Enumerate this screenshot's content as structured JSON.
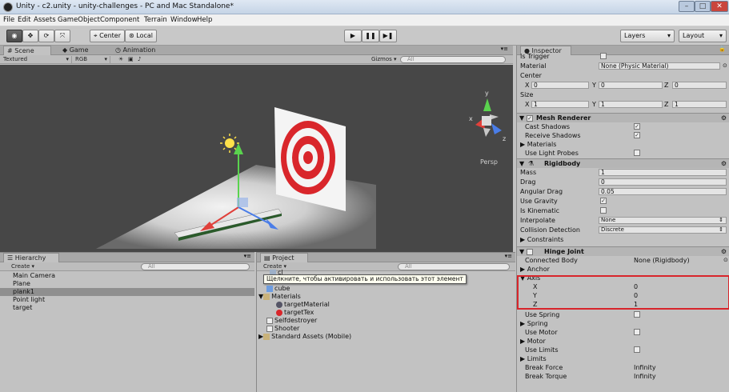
{
  "window": {
    "title": "Unity - c2.unity - unity-challenges - PC and Mac Standalone*"
  },
  "menu": [
    "File",
    "Edit",
    "Assets",
    "GameObject",
    "Component",
    "Terrain",
    "Window",
    "Help"
  ],
  "toolbar": {
    "center": "Center",
    "local": "Local",
    "layers": "Layers",
    "layout": "Layout"
  },
  "scene": {
    "tabs": [
      "Scene",
      "Game",
      "Animation"
    ],
    "shading": "Textured",
    "render": "RGB",
    "gizmos": "Gizmos",
    "search": "All",
    "persp": "Persp",
    "gizmo_axes": {
      "x": "x",
      "y": "y",
      "z": "z"
    }
  },
  "hierarchy": {
    "title": "Hierarchy",
    "create": "Create",
    "search": "All",
    "items": [
      "Main Camera",
      "Plane",
      "plank1",
      "Point light",
      "target"
    ]
  },
  "project": {
    "title": "Project",
    "create": "Create",
    "search": "All",
    "tooltip": "Щелкните, чтобы активировать и использовать этот элемент",
    "partial_item": "cl",
    "items": [
      "cube",
      "Materials",
      "targetMaterial",
      "targetTex",
      "Selfdestroyer",
      "Shooter",
      "Standard Assets (Mobile)"
    ]
  },
  "inspector": {
    "title": "Inspector",
    "collider": {
      "is_trigger": "Is Trigger",
      "material_label": "Material",
      "material_value": "None (Physic Material)",
      "center_label": "Center",
      "center": {
        "x": "0",
        "y": "0",
        "z": "0"
      },
      "size_label": "Size",
      "size": {
        "x": "1",
        "y": "1",
        "z": "1"
      }
    },
    "mesh_renderer": {
      "title": "Mesh Renderer",
      "cast_shadows": "Cast Shadows",
      "receive_shadows": "Receive Shadows",
      "materials": "Materials",
      "use_light_probes": "Use Light Probes"
    },
    "rigidbody": {
      "title": "Rigidbody",
      "mass_label": "Mass",
      "mass": "1",
      "drag_label": "Drag",
      "drag": "0",
      "angular_drag_label": "Angular Drag",
      "angular_drag": "0.05",
      "use_gravity": "Use Gravity",
      "is_kinematic": "Is Kinematic",
      "interpolate_label": "Interpolate",
      "interpolate": "None",
      "collision_label": "Collision Detection",
      "collision": "Discrete",
      "constraints": "Constraints"
    },
    "hinge_joint": {
      "title": "Hinge Joint",
      "connected_body_label": "Connected Body",
      "connected_body": "None (Rigidbody)",
      "anchor": "Anchor",
      "axis": "Axis",
      "axis_x_label": "X",
      "axis_x": "0",
      "axis_y_label": "Y",
      "axis_y": "0",
      "axis_z_label": "Z",
      "axis_z": "1",
      "use_spring": "Use Spring",
      "spring": "Spring",
      "use_motor": "Use Motor",
      "motor": "Motor",
      "use_limits": "Use Limits",
      "limits": "Limits",
      "break_force_label": "Break Force",
      "break_force": "Infinity",
      "break_torque_label": "Break Torque",
      "break_torque": "Infinity"
    }
  },
  "colors": {
    "highlight": "#d8252b",
    "target_red": "#d9262b",
    "selection": "#8f8f8f"
  }
}
